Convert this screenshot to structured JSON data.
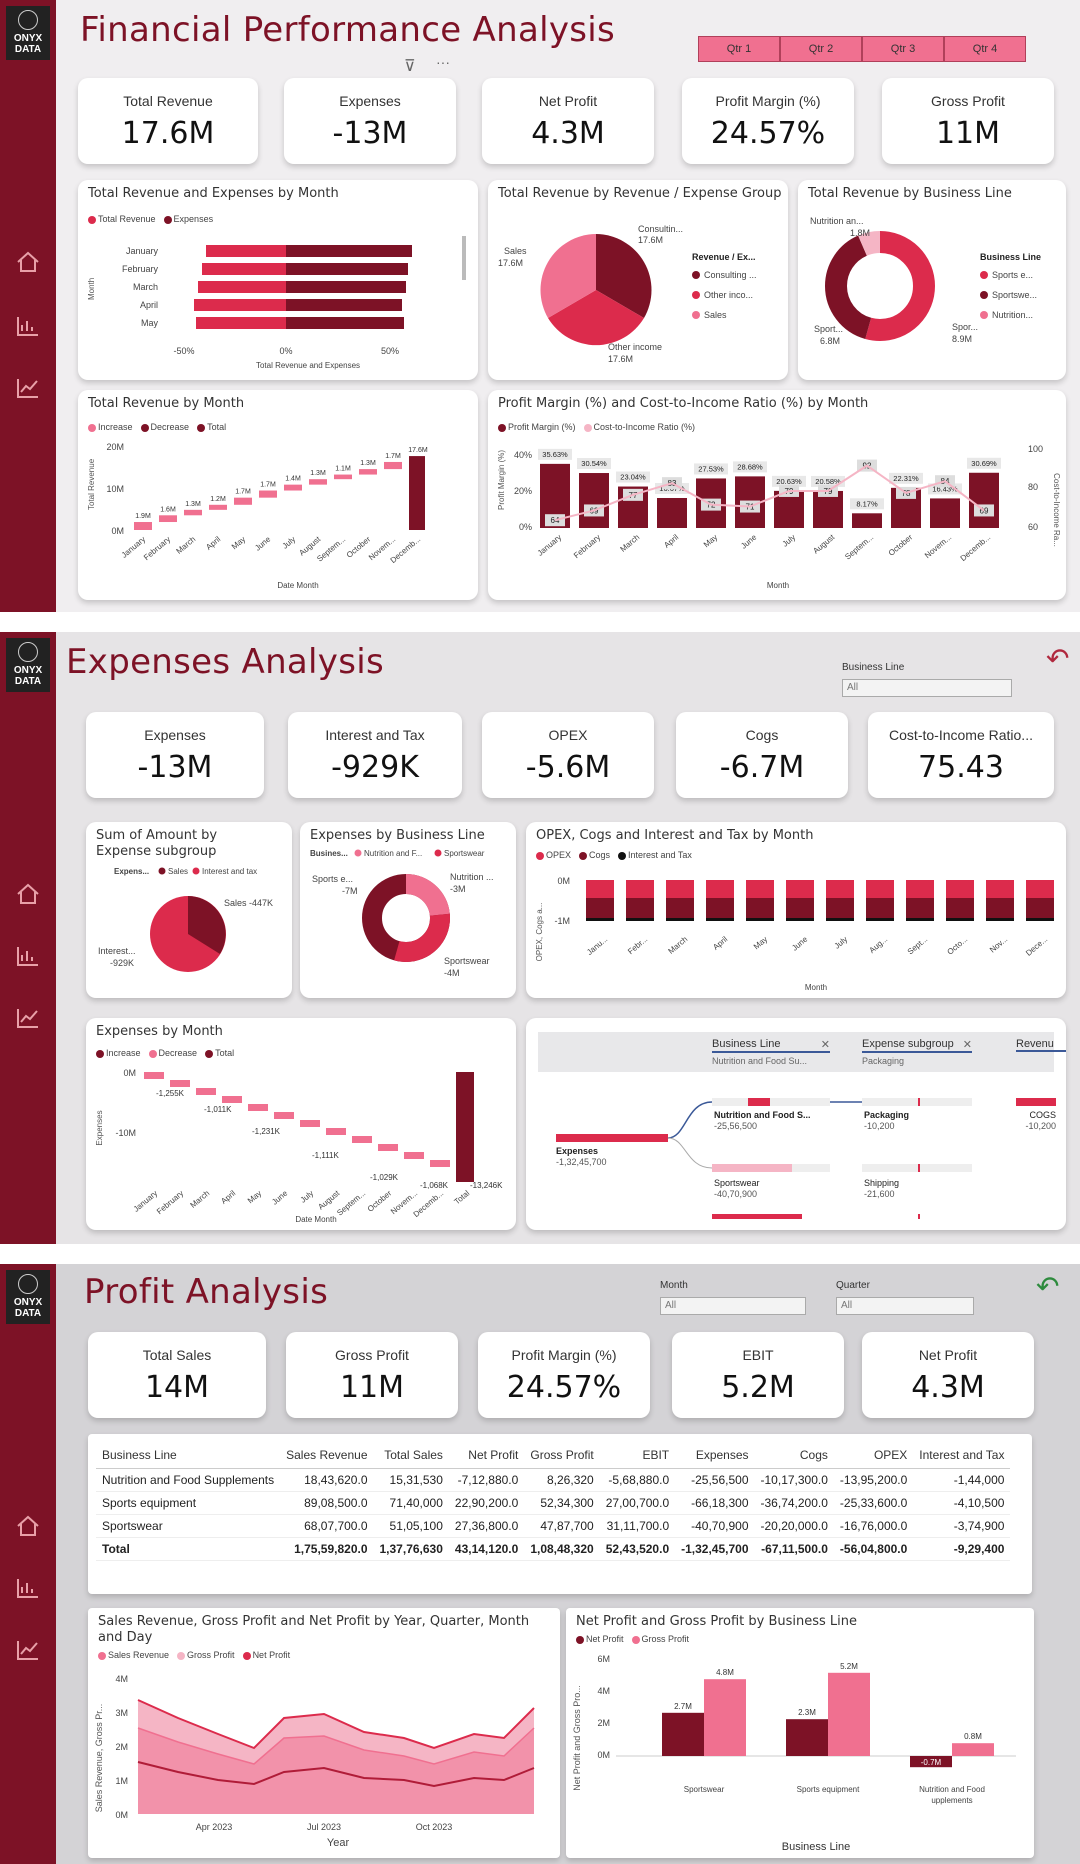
{
  "brand": {
    "logo": "ONYX DATA"
  },
  "p1": {
    "title": "Financial Performance Analysis",
    "quarters": [
      "Qtr 1",
      "Qtr 2",
      "Qtr 3",
      "Qtr 4"
    ],
    "kpis": [
      {
        "label": "Total Revenue",
        "value": "17.6M"
      },
      {
        "label": "Expenses",
        "value": "-13M"
      },
      {
        "label": "Net Profit",
        "value": "4.3M"
      },
      {
        "label": "Profit Margin (%)",
        "value": "24.57%"
      },
      {
        "label": "Gross Profit",
        "value": "11M"
      }
    ],
    "rev_exp": {
      "title": "Total Revenue and Expenses by Month",
      "legend": [
        "Total Revenue",
        "Expenses"
      ],
      "ylabel": "Month",
      "xlabel": "Total Revenue and Expenses",
      "ticks": [
        "-50%",
        "0%",
        "50%"
      ],
      "months": [
        "January",
        "February",
        "March",
        "April",
        "May"
      ]
    },
    "rev_group": {
      "title": "Total Revenue by Revenue / Expense Group",
      "legend_title": "Revenue / Ex...",
      "legend": [
        "Consulting ...",
        "Other inco...",
        "Sales"
      ],
      "labels": {
        "consulting": "Consultin...",
        "consulting_v": "17.6M",
        "sales": "Sales",
        "sales_v": "17.6M",
        "other": "Other income",
        "other_v": "17.6M"
      }
    },
    "rev_line": {
      "title": "Total Revenue by Business Line",
      "legend_title": "Business Line",
      "legend": [
        "Sports e...",
        "Sportswe...",
        "Nutrition..."
      ],
      "labels": {
        "nutri": "Nutrition an...",
        "nutri_v": "1.8M",
        "sport": "Sport...",
        "sport_v": "6.8M",
        "spor": "Spor...",
        "spor_v": "8.9M"
      }
    },
    "rev_month": {
      "title": "Total Revenue by Month",
      "legend": [
        "Increase",
        "Decrease",
        "Total"
      ],
      "ylabel": "Total Revenue",
      "xlabel": "Date Month",
      "yticks": [
        "20M",
        "10M",
        "0M"
      ],
      "months": [
        "January",
        "February",
        "March",
        "April",
        "May",
        "June",
        "July",
        "August",
        "Septem...",
        "October",
        "Novem...",
        "Decemb...",
        "Total"
      ],
      "labels": [
        "1.9M",
        "1.6M",
        "1.3M",
        "1.2M",
        "1.7M",
        "1.7M",
        "1.4M",
        "1.3M",
        "1.1M",
        "1.3M",
        "1.7M",
        "17.6M"
      ]
    },
    "pm": {
      "title": "Profit Margin (%) and Cost-to-Income Ratio (%) by Month",
      "legend": [
        "Profit Margin (%)",
        "Cost-to-Income Ratio (%)"
      ],
      "ylabel": "Profit Margin (%)",
      "y2label": "Cost-to-Income Ra...",
      "xlabel": "Month",
      "yticks": [
        "40%",
        "20%",
        "0%"
      ],
      "y2ticks": [
        "100",
        "80",
        "60"
      ],
      "months": [
        "January",
        "February",
        "March",
        "April",
        "May",
        "June",
        "July",
        "August",
        "Septem...",
        "October",
        "Novem...",
        "Decemb..."
      ],
      "labels": [
        "35.63%",
        "30.54%",
        "23.04%",
        "16.67%",
        "27.53%",
        "28.68%",
        "20.63%",
        "20.58%",
        "8.17%",
        "22.31%",
        "16.43%",
        "30.69%"
      ],
      "ratio_labels": [
        "64",
        "69",
        "77",
        "83",
        "72",
        "71",
        "79",
        "79",
        "92",
        "78",
        "84",
        "69"
      ]
    }
  },
  "p2": {
    "title": "Expenses Analysis",
    "slicer": {
      "label": "Business Line",
      "value": "All"
    },
    "kpis": [
      {
        "label": "Expenses",
        "value": "-13M"
      },
      {
        "label": "Interest and Tax",
        "value": "-929K"
      },
      {
        "label": "OPEX",
        "value": "-5.6M"
      },
      {
        "label": "Cogs",
        "value": "-6.7M"
      },
      {
        "label": "Cost-to-Income Ratio...",
        "value": "75.43"
      }
    ],
    "sub": {
      "title": "Sum of Amount by Expense subgroup",
      "legend_title": "Expens...",
      "legend": [
        "Sales",
        "Interest and tax"
      ],
      "sales": "Sales -447K",
      "interest": "Interest...",
      "interest_v": "-929K"
    },
    "bl": {
      "title": "Expenses by Business Line",
      "legend_title": "Busines...",
      "legend": [
        "Nutrition and F...",
        "Sportswear"
      ],
      "sports": "Sports e...",
      "sports_v": "-7M",
      "nutri": "Nutrition ...",
      "nutri_v": "-3M",
      "sw": "Sportswear",
      "sw_v": "-4M"
    },
    "ocm": {
      "title": "OPEX, Cogs and Interest and Tax by Month",
      "legend": [
        "OPEX",
        "Cogs",
        "Interest and Tax"
      ],
      "ylabel": "OPEX, Cogs a...",
      "xlabel": "Month",
      "yticks": [
        "0M",
        "-1M"
      ],
      "months": [
        "Janu...",
        "Febr...",
        "March",
        "April",
        "May",
        "June",
        "July",
        "Aug...",
        "Sept...",
        "Octo...",
        "Nov...",
        "Dece..."
      ]
    },
    "em": {
      "title": "Expenses by Month",
      "legend": [
        "Increase",
        "Decrease",
        "Total"
      ],
      "ylabel": "Expenses",
      "xlabel": "Date Month",
      "yticks": [
        "0M",
        "-10M"
      ],
      "months": [
        "January",
        "February",
        "March",
        "April",
        "May",
        "June",
        "July",
        "August",
        "Septem...",
        "October",
        "Novem...",
        "Decemb...",
        "Total"
      ],
      "labels": [
        "-1,255K",
        "-1,011K",
        "-1,231K",
        "-1,111K",
        "-1,029K",
        "-1,068K",
        "-13,246K"
      ]
    },
    "tree": {
      "headers": [
        {
          "t": "Business Line",
          "s": "Nutrition and Food Su..."
        },
        {
          "t": "Expense subgroup",
          "s": "Packaging"
        },
        {
          "t": "Revenu",
          "s": ""
        }
      ],
      "nodes": {
        "root": "Expenses",
        "root_v": "-1,32,45,700",
        "n1": "Nutrition and Food S...",
        "n1_v": "-25,56,500",
        "n2": "Sportswear",
        "n2_v": "-40,70,900",
        "p1": "Packaging",
        "p1_v": "-10,200",
        "p2": "Shipping",
        "p2_v": "-21,600",
        "c": "COGS",
        "c_v": "-10,200"
      }
    }
  },
  "p3": {
    "title": "Profit Analysis",
    "slicers": [
      {
        "label": "Month",
        "value": "All"
      },
      {
        "label": "Quarter",
        "value": "All"
      }
    ],
    "kpis": [
      {
        "label": "Total Sales",
        "value": "14M"
      },
      {
        "label": "Gross Profit",
        "value": "11M"
      },
      {
        "label": "Profit Margin (%)",
        "value": "24.57%"
      },
      {
        "label": "EBIT",
        "value": "5.2M"
      },
      {
        "label": "Net Profit",
        "value": "4.3M"
      }
    ],
    "table": {
      "headers": [
        "Business Line",
        "Sales Revenue",
        "Total Sales",
        "Net Profit",
        "Gross Profit",
        "EBIT",
        "Expenses",
        "Cogs",
        "OPEX",
        "Interest and Tax"
      ],
      "rows": [
        [
          "Nutrition and Food Supplements",
          "18,43,620.0",
          "15,31,530",
          "-7,12,880.0",
          "8,26,320",
          "-5,68,880.0",
          "-25,56,500",
          "-10,17,300.0",
          "-13,95,200.0",
          "-1,44,000"
        ],
        [
          "Sports equipment",
          "89,08,500.0",
          "71,40,000",
          "22,90,200.0",
          "52,34,300",
          "27,00,700.0",
          "-66,18,300",
          "-36,74,200.0",
          "-25,33,600.0",
          "-4,10,500"
        ],
        [
          "Sportswear",
          "68,07,700.0",
          "51,05,100",
          "27,36,800.0",
          "47,87,700",
          "31,11,700.0",
          "-40,70,900",
          "-20,20,000.0",
          "-16,76,000.0",
          "-3,74,900"
        ]
      ],
      "total": [
        "Total",
        "1,75,59,820.0",
        "1,37,76,630",
        "43,14,120.0",
        "1,08,48,320",
        "52,43,520.0",
        "-1,32,45,700",
        "-67,11,500.0",
        "-56,04,800.0",
        "-9,29,400"
      ]
    },
    "area": {
      "title": "Sales Revenue, Gross Profit and Net Profit by Year, Quarter, Month and Day",
      "legend": [
        "Sales Revenue",
        "Gross Profit",
        "Net Profit"
      ],
      "ylabel": "Sales Revenue, Gross Pr...",
      "xlabel": "Year",
      "yticks": [
        "4M",
        "3M",
        "2M",
        "1M",
        "0M"
      ],
      "xticks": [
        "Apr 2023",
        "Jul 2023",
        "Oct 2023"
      ]
    },
    "bars": {
      "title": "Net Profit and Gross Profit by Business Line",
      "legend": [
        "Net Profit",
        "Gross Profit"
      ],
      "ylabel": "Net Profit and Gross Pro...",
      "xlabel": "Business Line",
      "yticks": [
        "6M",
        "4M",
        "2M",
        "0M"
      ],
      "categories": [
        "Sportswear",
        "Sports equipment",
        "Nutrition and Food Supplements"
      ],
      "net": [
        2.7,
        2.3,
        -0.7
      ],
      "gross": [
        4.8,
        5.2,
        0.8
      ],
      "net_labels": [
        "2.7M",
        "2.3M",
        "-0.7M"
      ],
      "gross_labels": [
        "4.8M",
        "5.2M",
        "0.8M"
      ]
    }
  },
  "chart_data": [
    {
      "type": "bar",
      "title": "Total Revenue by Month",
      "categories": [
        "January",
        "February",
        "March",
        "April",
        "May",
        "June",
        "July",
        "August",
        "Septem...",
        "October",
        "Novem...",
        "Decemb...",
        "Total"
      ],
      "values": [
        1.9,
        1.6,
        1.3,
        1.2,
        1.7,
        1.7,
        1.4,
        1.3,
        1.1,
        1.3,
        1.7,
        17.6
      ],
      "ylabel": "Total Revenue"
    },
    {
      "type": "bar",
      "title": "Profit Margin (%) and Cost-to-Income Ratio (%) by Month",
      "categories": [
        "January",
        "February",
        "March",
        "April",
        "May",
        "June",
        "July",
        "August",
        "Septem...",
        "October",
        "Novem...",
        "Decemb..."
      ],
      "series": [
        {
          "name": "Profit Margin (%)",
          "values": [
            35.63,
            30.54,
            23.04,
            16.67,
            27.53,
            28.68,
            20.63,
            20.58,
            8.17,
            22.31,
            16.43,
            30.69
          ]
        },
        {
          "name": "Cost-to-Income Ratio (%)",
          "values": [
            64,
            69,
            77,
            83,
            72,
            71,
            79,
            79,
            92,
            78,
            84,
            69
          ]
        }
      ]
    },
    {
      "type": "bar",
      "title": "Net Profit and Gross Profit by Business Line",
      "categories": [
        "Sportswear",
        "Sports equipment",
        "Nutrition and Food Supplements"
      ],
      "series": [
        {
          "name": "Net Profit",
          "values": [
            2.7,
            2.3,
            -0.7
          ]
        },
        {
          "name": "Gross Profit",
          "values": [
            4.8,
            5.2,
            0.8
          ]
        }
      ]
    }
  ],
  "colors": {
    "dark": "#7d1226",
    "mid": "#dc2b4c",
    "pink": "#f07090",
    "light": "#f5b5c5"
  }
}
